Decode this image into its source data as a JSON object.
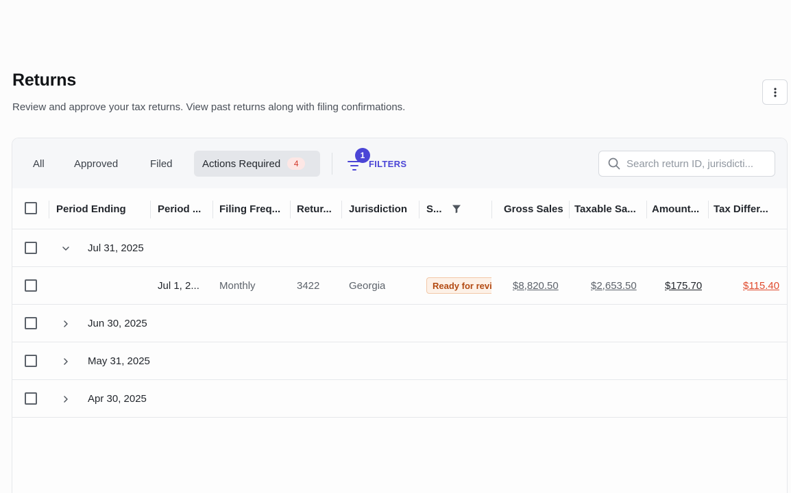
{
  "page": {
    "title": "Returns",
    "subtitle": "Review and approve your tax returns. View past returns along with filing confirmations."
  },
  "toolbar": {
    "tabs": [
      {
        "label": "All"
      },
      {
        "label": "Approved"
      },
      {
        "label": "Filed"
      },
      {
        "label": "Actions Required",
        "count": "4",
        "active": true
      }
    ],
    "filters_label": "FILTERS",
    "filters_count": "1",
    "search_placeholder": "Search return ID, jurisdicti..."
  },
  "table": {
    "columns": [
      "Period Ending",
      "Period ...",
      "Filing Freq...",
      "Retur...",
      "Jurisdiction",
      "S...",
      "Gross Sales",
      "Taxable Sa...",
      "Amount...",
      "Tax Differ..."
    ],
    "groups": [
      {
        "date": "Jul 31, 2025",
        "expanded": true,
        "rows": [
          {
            "period": "Jul 1, 2...",
            "frequency": "Monthly",
            "return_id": "3422",
            "jurisdiction": "Georgia",
            "status": "Ready for revi",
            "gross_sales": "$8,820.50",
            "taxable_sales": "$2,653.50",
            "amount": "$175.70",
            "tax_difference": "$115.40"
          }
        ]
      },
      {
        "date": "Jun 30, 2025",
        "expanded": false
      },
      {
        "date": "May 31, 2025",
        "expanded": false
      },
      {
        "date": "Apr 30, 2025",
        "expanded": false
      }
    ]
  },
  "colors": {
    "accent": "#4b45d6",
    "badge_red": "#d33a2c",
    "status_orange": "#b34a12",
    "negative_red": "#e04a2d"
  },
  "icons": [
    "more-vertical-icon",
    "filter-lines-icon",
    "search-icon",
    "funnel-icon",
    "chevron-down-icon",
    "chevron-right-icon"
  ]
}
